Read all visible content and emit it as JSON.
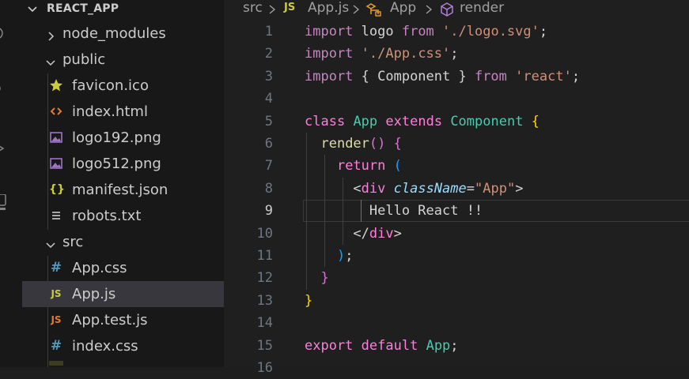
{
  "explorer": {
    "title": "REACT_APP",
    "items": [
      {
        "label": "node_modules",
        "type": "folder",
        "expanded": false
      },
      {
        "label": "public",
        "type": "folder",
        "expanded": true
      },
      {
        "label": "favicon.ico",
        "type": "file",
        "icon": "star-icon"
      },
      {
        "label": "index.html",
        "type": "file",
        "icon": "html-icon"
      },
      {
        "label": "logo192.png",
        "type": "file",
        "icon": "image-icon"
      },
      {
        "label": "logo512.png",
        "type": "file",
        "icon": "image-icon"
      },
      {
        "label": "manifest.json",
        "type": "file",
        "icon": "json-icon",
        "glyph": "{}"
      },
      {
        "label": "robots.txt",
        "type": "file",
        "icon": "text-lines-icon"
      },
      {
        "label": "src",
        "type": "folder",
        "expanded": true
      },
      {
        "label": "App.css",
        "type": "file",
        "icon": "css-icon",
        "glyph": "#"
      },
      {
        "label": "App.js",
        "type": "file",
        "icon": "js-icon",
        "glyph": "JS",
        "selected": true
      },
      {
        "label": "App.test.js",
        "type": "file",
        "icon": "js-icon",
        "glyph": "JS"
      },
      {
        "label": "index.css",
        "type": "file",
        "icon": "css-icon",
        "glyph": "#"
      }
    ]
  },
  "breadcrumb": {
    "folder": "src",
    "file_badge": "JS",
    "file": "App.js",
    "component": "App",
    "method": "render"
  },
  "editor": {
    "active_line": 9,
    "line_numbers": [
      "1",
      "2",
      "3",
      "4",
      "5",
      "6",
      "7",
      "8",
      "9",
      "10",
      "11",
      "12",
      "13",
      "14",
      "15",
      "16"
    ],
    "lines": [
      [
        {
          "t": "import",
          "c": "kw"
        },
        {
          "t": " logo ",
          "c": "plain"
        },
        {
          "t": "from",
          "c": "kw"
        },
        {
          "t": " ",
          "c": "plain"
        },
        {
          "t": "'./logo.svg'",
          "c": "str"
        },
        {
          "t": ";",
          "c": "plain"
        }
      ],
      [
        {
          "t": "import",
          "c": "kw"
        },
        {
          "t": " ",
          "c": "plain"
        },
        {
          "t": "'./App.css'",
          "c": "str"
        },
        {
          "t": ";",
          "c": "plain"
        }
      ],
      [
        {
          "t": "import",
          "c": "kw"
        },
        {
          "t": " { Component } ",
          "c": "plain"
        },
        {
          "t": "from",
          "c": "kw"
        },
        {
          "t": " ",
          "c": "plain"
        },
        {
          "t": "'react'",
          "c": "str"
        },
        {
          "t": ";",
          "c": "plain"
        }
      ],
      [],
      [
        {
          "t": "class",
          "c": "pk"
        },
        {
          "t": " ",
          "c": "plain"
        },
        {
          "t": "App",
          "c": "cls"
        },
        {
          "t": " ",
          "c": "plain"
        },
        {
          "t": "extends",
          "c": "pk"
        },
        {
          "t": " ",
          "c": "plain"
        },
        {
          "t": "Component",
          "c": "cls"
        },
        {
          "t": " ",
          "c": "plain"
        },
        {
          "t": "{",
          "c": "yellow-br"
        }
      ],
      [
        {
          "t": "  ",
          "c": "plain"
        },
        {
          "t": "render",
          "c": "fn"
        },
        {
          "t": "()",
          "c": "pink-br"
        },
        {
          "t": " ",
          "c": "plain"
        },
        {
          "t": "{",
          "c": "pink-br"
        }
      ],
      [
        {
          "t": "    ",
          "c": "plain"
        },
        {
          "t": "return",
          "c": "pk"
        },
        {
          "t": " ",
          "c": "plain"
        },
        {
          "t": "(",
          "c": "blue-br"
        }
      ],
      [
        {
          "t": "      ",
          "c": "plain"
        },
        {
          "t": "<",
          "c": "plain"
        },
        {
          "t": "div",
          "c": "pk"
        },
        {
          "t": " ",
          "c": "plain"
        },
        {
          "t": "className",
          "c": "attr"
        },
        {
          "t": "=",
          "c": "plain"
        },
        {
          "t": "\"App\"",
          "c": "str"
        },
        {
          "t": ">",
          "c": "plain"
        }
      ],
      [
        {
          "t": "        Hello React !!",
          "c": "plain"
        }
      ],
      [
        {
          "t": "      ",
          "c": "plain"
        },
        {
          "t": "</",
          "c": "plain"
        },
        {
          "t": "div",
          "c": "pk"
        },
        {
          "t": ">",
          "c": "plain"
        }
      ],
      [
        {
          "t": "    ",
          "c": "plain"
        },
        {
          "t": ")",
          "c": "blue-br"
        },
        {
          "t": ";",
          "c": "plain"
        }
      ],
      [
        {
          "t": "  ",
          "c": "plain"
        },
        {
          "t": "}",
          "c": "pink-br"
        }
      ],
      [
        {
          "t": "}",
          "c": "yellow-br"
        }
      ],
      [],
      [
        {
          "t": "export",
          "c": "pk"
        },
        {
          "t": " ",
          "c": "plain"
        },
        {
          "t": "default",
          "c": "pk"
        },
        {
          "t": " ",
          "c": "plain"
        },
        {
          "t": "App",
          "c": "cls"
        },
        {
          "t": ";",
          "c": "plain"
        }
      ],
      []
    ]
  },
  "colors": {
    "keyword": "#ff7edb",
    "string": "#ce9178",
    "class": "#4ec9b0",
    "function": "#dcdcaa",
    "attribute": "#9cdcfe",
    "js_badge": "#cbcb41",
    "css_badge": "#519aba",
    "html_icon": "#e37933",
    "json_icon": "#cbcb41"
  }
}
